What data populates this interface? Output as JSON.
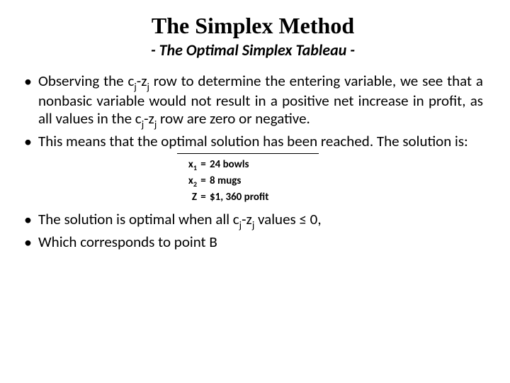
{
  "title": "The Simplex Method",
  "subtitle": "- The Optimal Simplex Tableau -",
  "bullets": {
    "b1": {
      "pre": "Observing the c",
      "sub1": "j",
      "mid1": "-z",
      "sub2": "j",
      "mid2": " row to determine the entering variable, we see that a nonbasic variable would not result in a positive net increase in profit, as all values in the c",
      "sub3": "j",
      "mid3": "-z",
      "sub4": "j",
      "post": " row are zero or negative."
    },
    "b2": "This means that the optimal solution has been reached. The solution is:",
    "b3": {
      "pre": "The solution is optimal when all c",
      "sub1": "j",
      "mid": "-z",
      "sub2": "j",
      "post": " values ≤ 0,"
    },
    "b4": "Which corresponds to point B"
  },
  "solution": {
    "row1": {
      "var_base": "x",
      "var_sub": "1",
      "eq": "=",
      "val": "24 bowls"
    },
    "row2": {
      "var_base": "x",
      "var_sub": "2",
      "eq": "=",
      "val": "8 mugs"
    },
    "row3": {
      "var_base": "Z",
      "var_sub": "",
      "eq": "=",
      "val": "$1, 360 profit"
    }
  }
}
